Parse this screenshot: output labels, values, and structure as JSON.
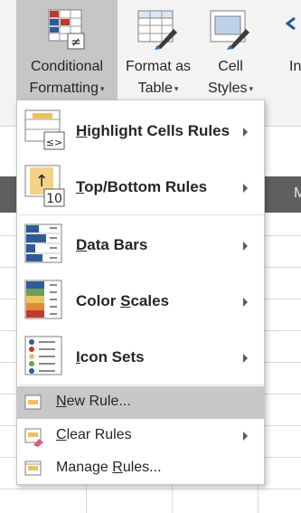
{
  "ribbon": {
    "conditional_formatting": {
      "line1": "Conditional",
      "line2": "Formatting"
    },
    "format_as_table": {
      "line1": "Format as",
      "line2": "Table"
    },
    "cell_styles": {
      "line1": "Cell",
      "line2": "Styles"
    },
    "insert_partial": "In",
    "caret": "▾"
  },
  "sheet": {
    "column_letter_partial": "M"
  },
  "menu": {
    "main_items": [
      {
        "pre": "",
        "key": "H",
        "post": "ighlight Cells Rules",
        "icon": "highlight-cells-rules-icon"
      },
      {
        "pre": "",
        "key": "T",
        "post": "op/Bottom Rules",
        "icon": "top-bottom-rules-icon"
      },
      {
        "pre": "",
        "key": "D",
        "post": "ata Bars",
        "icon": "data-bars-icon"
      },
      {
        "pre": "Color ",
        "key": "S",
        "post": "cales",
        "icon": "color-scales-icon"
      },
      {
        "pre": "",
        "key": "I",
        "post": "con Sets",
        "icon": "icon-sets-icon"
      }
    ],
    "new_rule": {
      "pre": "",
      "key": "N",
      "post": "ew Rule..."
    },
    "clear_rules": {
      "pre": "",
      "key": "C",
      "post": "lear Rules"
    },
    "manage_rules": {
      "pre": "Manage ",
      "key": "R",
      "post": "ules..."
    }
  },
  "icons": {
    "highlight_text": "≤>",
    "top_arrow": "↑",
    "top_number": "10",
    "not_equal": "≠"
  },
  "colors": {
    "ribbon_bg": "#f3f3f3",
    "active_button": "#c6c6c6",
    "hover_item": "#c8c8c8",
    "excel_blue": "#2e5c9a",
    "header_dark": "#5f5f5f"
  }
}
